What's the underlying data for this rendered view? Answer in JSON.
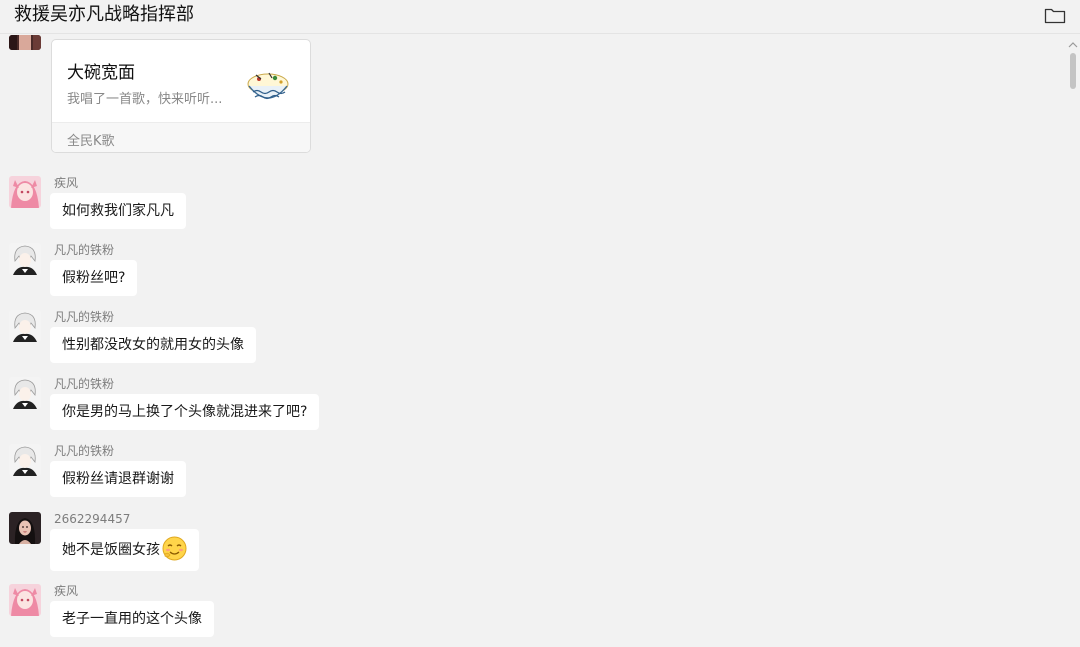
{
  "header": {
    "title": "救援吴亦凡战略指挥部",
    "folder_icon": "folder-icon"
  },
  "music_card": {
    "title": "大碗宽面",
    "description": "我唱了一首歌，快来听听...",
    "source": "全民K歌",
    "cover_icon": "bowl-noodles-cover"
  },
  "messages": [
    {
      "sender": "疾风",
      "text": "如何救我们家凡凡",
      "avatar": "pink-anime-avatar"
    },
    {
      "sender": "凡凡的铁粉",
      "text": "假粉丝吧?",
      "avatar": "white-hair-anime-avatar"
    },
    {
      "sender": "凡凡的铁粉",
      "text": "性别都没改女的就用女的头像",
      "avatar": "white-hair-anime-avatar"
    },
    {
      "sender": "凡凡的铁粉",
      "text": "你是男的马上换了个头像就混进来了吧?",
      "avatar": "white-hair-anime-avatar"
    },
    {
      "sender": "凡凡的铁粉",
      "text": "假粉丝请退群谢谢",
      "avatar": "white-hair-anime-avatar"
    },
    {
      "sender": "2662294457",
      "text": "她不是饭圈女孩",
      "avatar": "girl-photo-avatar",
      "emoji": "shy-laugh-emoji"
    },
    {
      "sender": "疾风",
      "text": "老子一直用的这个头像",
      "avatar": "pink-anime-avatar"
    }
  ],
  "colors": {
    "background": "#f2f2f2",
    "bubble": "#ffffff",
    "sender_text": "#7d7d7d"
  }
}
